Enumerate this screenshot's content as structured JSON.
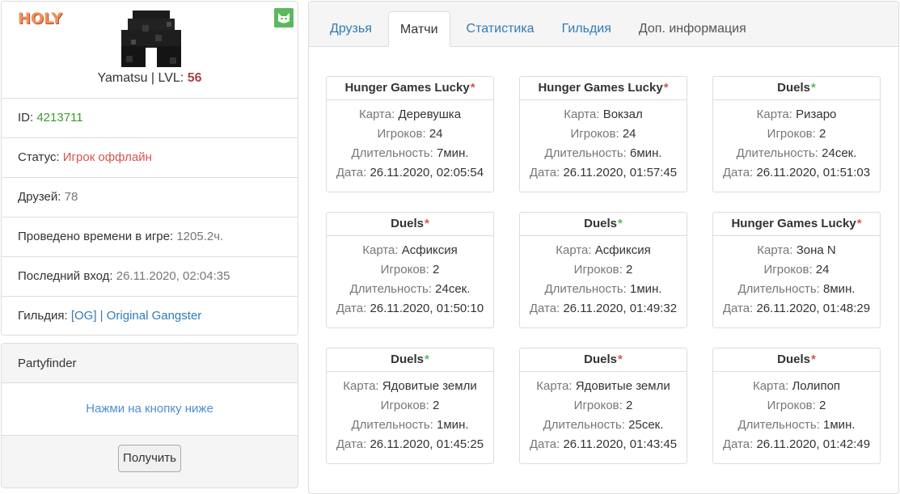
{
  "profile": {
    "badge": "HOLY",
    "nickname": "Yamatsu",
    "separator": " | ",
    "lvl_label": "LVL: ",
    "lvl_value": "56",
    "rows": {
      "id": {
        "label": "ID: ",
        "value": "4213711"
      },
      "status": {
        "label": "Статус: ",
        "value": "Игрок оффлайн"
      },
      "friends": {
        "label": "Друзей: ",
        "value": "78"
      },
      "playtime": {
        "label": "Проведено времени в игре: ",
        "value": "1205.2ч."
      },
      "last_login": {
        "label": "Последний вход: ",
        "value": "26.11.2020, 02:04:35"
      },
      "guild": {
        "label": "Гильдия: ",
        "value": "[OG] | Original Gangster"
      }
    },
    "corner_icon": "cat-face-icon",
    "colors": {
      "badge": "#f29059",
      "level": "#a94442",
      "id": "#3c9b2f",
      "status": "#d9534f",
      "link": "#337ab7"
    }
  },
  "partyfinder": {
    "title": "Partyfinder",
    "hint": "Нажми на кнопку ниже",
    "button_label": "Получить"
  },
  "tabs": [
    {
      "label": "Друзья",
      "active": false
    },
    {
      "label": "Матчи",
      "active": true
    },
    {
      "label": "Статистика",
      "active": false
    },
    {
      "label": "Гильдия",
      "active": false
    },
    {
      "label": "Доп. информация",
      "active": false
    }
  ],
  "labels": {
    "map": "Карта: ",
    "players": "Игроков: ",
    "duration": "Длительность: ",
    "date": "Дата: "
  },
  "matches": [
    {
      "mode": "Hunger Games Lucky",
      "result": "loss",
      "map": "Деревушка",
      "players": "24",
      "duration": "7мин.",
      "date": "26.11.2020, 02:05:54"
    },
    {
      "mode": "Hunger Games Lucky",
      "result": "loss",
      "map": "Вокзал",
      "players": "24",
      "duration": "6мин.",
      "date": "26.11.2020, 01:57:45"
    },
    {
      "mode": "Duels",
      "result": "win",
      "map": "Ризаро",
      "players": "2",
      "duration": "24сек.",
      "date": "26.11.2020, 01:51:03"
    },
    {
      "mode": "Duels",
      "result": "loss",
      "map": "Асфиксия",
      "players": "2",
      "duration": "24сек.",
      "date": "26.11.2020, 01:50:10"
    },
    {
      "mode": "Duels",
      "result": "win",
      "map": "Асфиксия",
      "players": "2",
      "duration": "1мин.",
      "date": "26.11.2020, 01:49:32"
    },
    {
      "mode": "Hunger Games Lucky",
      "result": "loss",
      "map": "Зона N",
      "players": "24",
      "duration": "8мин.",
      "date": "26.11.2020, 01:48:29"
    },
    {
      "mode": "Duels",
      "result": "win",
      "map": "Ядовитые земли",
      "players": "2",
      "duration": "1мин.",
      "date": "26.11.2020, 01:45:25"
    },
    {
      "mode": "Duels",
      "result": "loss",
      "map": "Ядовитые земли",
      "players": "2",
      "duration": "25сек.",
      "date": "26.11.2020, 01:43:45"
    },
    {
      "mode": "Duels",
      "result": "loss",
      "map": "Лолипоп",
      "players": "2",
      "duration": "1мин.",
      "date": "26.11.2020, 01:42:49"
    }
  ],
  "result_colors": {
    "win": "#5cb85c",
    "loss": "#d9534f"
  }
}
